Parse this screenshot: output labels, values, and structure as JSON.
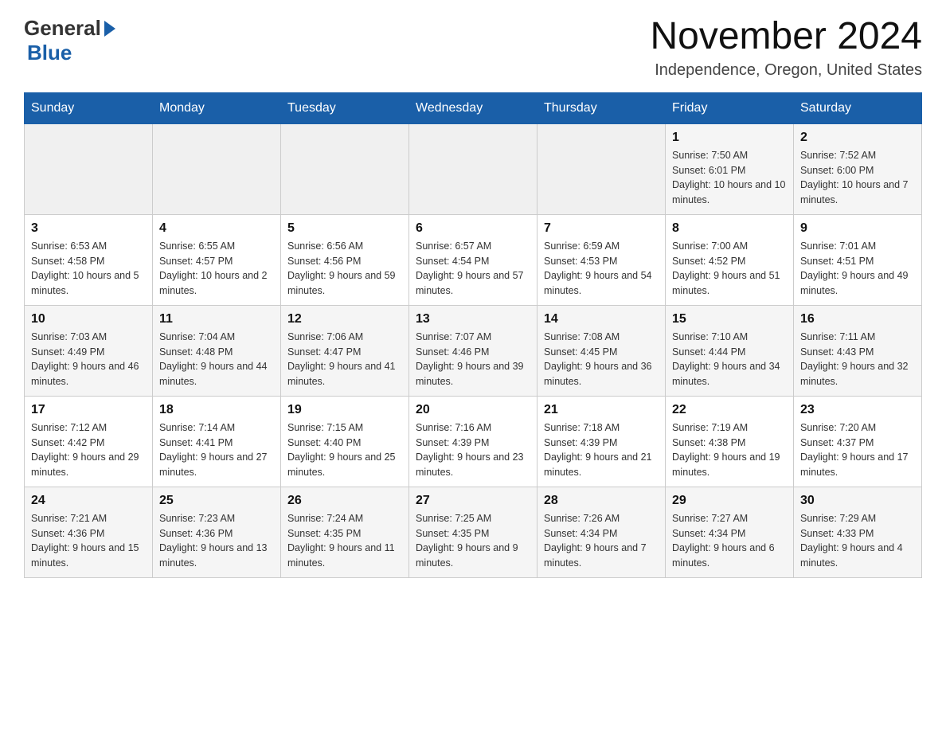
{
  "logo": {
    "general": "General",
    "blue": "Blue"
  },
  "title": "November 2024",
  "subtitle": "Independence, Oregon, United States",
  "header_days": [
    "Sunday",
    "Monday",
    "Tuesday",
    "Wednesday",
    "Thursday",
    "Friday",
    "Saturday"
  ],
  "weeks": [
    [
      {
        "day": "",
        "sunrise": "",
        "sunset": "",
        "daylight": ""
      },
      {
        "day": "",
        "sunrise": "",
        "sunset": "",
        "daylight": ""
      },
      {
        "day": "",
        "sunrise": "",
        "sunset": "",
        "daylight": ""
      },
      {
        "day": "",
        "sunrise": "",
        "sunset": "",
        "daylight": ""
      },
      {
        "day": "",
        "sunrise": "",
        "sunset": "",
        "daylight": ""
      },
      {
        "day": "1",
        "sunrise": "Sunrise: 7:50 AM",
        "sunset": "Sunset: 6:01 PM",
        "daylight": "Daylight: 10 hours and 10 minutes."
      },
      {
        "day": "2",
        "sunrise": "Sunrise: 7:52 AM",
        "sunset": "Sunset: 6:00 PM",
        "daylight": "Daylight: 10 hours and 7 minutes."
      }
    ],
    [
      {
        "day": "3",
        "sunrise": "Sunrise: 6:53 AM",
        "sunset": "Sunset: 4:58 PM",
        "daylight": "Daylight: 10 hours and 5 minutes."
      },
      {
        "day": "4",
        "sunrise": "Sunrise: 6:55 AM",
        "sunset": "Sunset: 4:57 PM",
        "daylight": "Daylight: 10 hours and 2 minutes."
      },
      {
        "day": "5",
        "sunrise": "Sunrise: 6:56 AM",
        "sunset": "Sunset: 4:56 PM",
        "daylight": "Daylight: 9 hours and 59 minutes."
      },
      {
        "day": "6",
        "sunrise": "Sunrise: 6:57 AM",
        "sunset": "Sunset: 4:54 PM",
        "daylight": "Daylight: 9 hours and 57 minutes."
      },
      {
        "day": "7",
        "sunrise": "Sunrise: 6:59 AM",
        "sunset": "Sunset: 4:53 PM",
        "daylight": "Daylight: 9 hours and 54 minutes."
      },
      {
        "day": "8",
        "sunrise": "Sunrise: 7:00 AM",
        "sunset": "Sunset: 4:52 PM",
        "daylight": "Daylight: 9 hours and 51 minutes."
      },
      {
        "day": "9",
        "sunrise": "Sunrise: 7:01 AM",
        "sunset": "Sunset: 4:51 PM",
        "daylight": "Daylight: 9 hours and 49 minutes."
      }
    ],
    [
      {
        "day": "10",
        "sunrise": "Sunrise: 7:03 AM",
        "sunset": "Sunset: 4:49 PM",
        "daylight": "Daylight: 9 hours and 46 minutes."
      },
      {
        "day": "11",
        "sunrise": "Sunrise: 7:04 AM",
        "sunset": "Sunset: 4:48 PM",
        "daylight": "Daylight: 9 hours and 44 minutes."
      },
      {
        "day": "12",
        "sunrise": "Sunrise: 7:06 AM",
        "sunset": "Sunset: 4:47 PM",
        "daylight": "Daylight: 9 hours and 41 minutes."
      },
      {
        "day": "13",
        "sunrise": "Sunrise: 7:07 AM",
        "sunset": "Sunset: 4:46 PM",
        "daylight": "Daylight: 9 hours and 39 minutes."
      },
      {
        "day": "14",
        "sunrise": "Sunrise: 7:08 AM",
        "sunset": "Sunset: 4:45 PM",
        "daylight": "Daylight: 9 hours and 36 minutes."
      },
      {
        "day": "15",
        "sunrise": "Sunrise: 7:10 AM",
        "sunset": "Sunset: 4:44 PM",
        "daylight": "Daylight: 9 hours and 34 minutes."
      },
      {
        "day": "16",
        "sunrise": "Sunrise: 7:11 AM",
        "sunset": "Sunset: 4:43 PM",
        "daylight": "Daylight: 9 hours and 32 minutes."
      }
    ],
    [
      {
        "day": "17",
        "sunrise": "Sunrise: 7:12 AM",
        "sunset": "Sunset: 4:42 PM",
        "daylight": "Daylight: 9 hours and 29 minutes."
      },
      {
        "day": "18",
        "sunrise": "Sunrise: 7:14 AM",
        "sunset": "Sunset: 4:41 PM",
        "daylight": "Daylight: 9 hours and 27 minutes."
      },
      {
        "day": "19",
        "sunrise": "Sunrise: 7:15 AM",
        "sunset": "Sunset: 4:40 PM",
        "daylight": "Daylight: 9 hours and 25 minutes."
      },
      {
        "day": "20",
        "sunrise": "Sunrise: 7:16 AM",
        "sunset": "Sunset: 4:39 PM",
        "daylight": "Daylight: 9 hours and 23 minutes."
      },
      {
        "day": "21",
        "sunrise": "Sunrise: 7:18 AM",
        "sunset": "Sunset: 4:39 PM",
        "daylight": "Daylight: 9 hours and 21 minutes."
      },
      {
        "day": "22",
        "sunrise": "Sunrise: 7:19 AM",
        "sunset": "Sunset: 4:38 PM",
        "daylight": "Daylight: 9 hours and 19 minutes."
      },
      {
        "day": "23",
        "sunrise": "Sunrise: 7:20 AM",
        "sunset": "Sunset: 4:37 PM",
        "daylight": "Daylight: 9 hours and 17 minutes."
      }
    ],
    [
      {
        "day": "24",
        "sunrise": "Sunrise: 7:21 AM",
        "sunset": "Sunset: 4:36 PM",
        "daylight": "Daylight: 9 hours and 15 minutes."
      },
      {
        "day": "25",
        "sunrise": "Sunrise: 7:23 AM",
        "sunset": "Sunset: 4:36 PM",
        "daylight": "Daylight: 9 hours and 13 minutes."
      },
      {
        "day": "26",
        "sunrise": "Sunrise: 7:24 AM",
        "sunset": "Sunset: 4:35 PM",
        "daylight": "Daylight: 9 hours and 11 minutes."
      },
      {
        "day": "27",
        "sunrise": "Sunrise: 7:25 AM",
        "sunset": "Sunset: 4:35 PM",
        "daylight": "Daylight: 9 hours and 9 minutes."
      },
      {
        "day": "28",
        "sunrise": "Sunrise: 7:26 AM",
        "sunset": "Sunset: 4:34 PM",
        "daylight": "Daylight: 9 hours and 7 minutes."
      },
      {
        "day": "29",
        "sunrise": "Sunrise: 7:27 AM",
        "sunset": "Sunset: 4:34 PM",
        "daylight": "Daylight: 9 hours and 6 minutes."
      },
      {
        "day": "30",
        "sunrise": "Sunrise: 7:29 AM",
        "sunset": "Sunset: 4:33 PM",
        "daylight": "Daylight: 9 hours and 4 minutes."
      }
    ]
  ]
}
